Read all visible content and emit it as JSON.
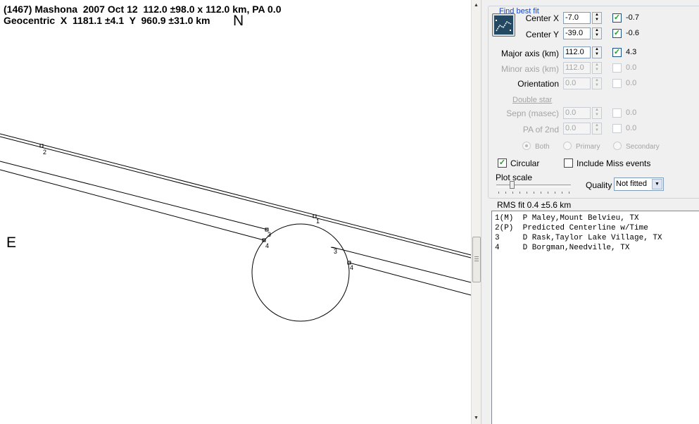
{
  "plot": {
    "header_line1": "(1467) Mashona  2007 Oct 12  112.0 ±98.0 x 112.0 km, PA 0.0",
    "header_line2": "Geocentric  X  1181.1 ±4.1  Y  960.9 ±31.0 km",
    "north_label": "N",
    "east_label": "E",
    "chord_markers": [
      {
        "label": "2"
      },
      {
        "label": "1"
      },
      {
        "label": "3"
      },
      {
        "label": "4"
      },
      {
        "label": "3"
      },
      {
        "label": "4"
      }
    ]
  },
  "panel": {
    "group_title": "Find best fit",
    "fit_button_icon": "fit-chart-icon",
    "params": [
      {
        "label": "Center X",
        "value": "-7.0",
        "checked": true,
        "result": "-0.7",
        "enabled": true
      },
      {
        "label": "Center Y",
        "value": "-39.0",
        "checked": true,
        "result": "-0.6",
        "enabled": true
      },
      {
        "label": "Major axis (km)",
        "value": "112.0",
        "checked": true,
        "result": "4.3",
        "enabled": true
      },
      {
        "label": "Minor axis (km)",
        "value": "112.0",
        "checked": false,
        "result": "0.0",
        "enabled": false
      },
      {
        "label": "Orientation",
        "value": "0.0",
        "checked": false,
        "result": "0.0",
        "enabled": false
      }
    ],
    "double_star_label": "Double star",
    "double_star": [
      {
        "label": "Sepn (masec)",
        "value": "0.0",
        "checked": false,
        "result": "0.0"
      },
      {
        "label": "PA of 2nd",
        "value": "0.0",
        "checked": false,
        "result": "0.0"
      }
    ],
    "radios": [
      "Both",
      "Primary",
      "Secondary"
    ],
    "radio_selected": "Both",
    "circular_label": "Circular",
    "circular_checked": true,
    "miss_label": "Include Miss events",
    "miss_checked": false,
    "plot_scale_label": "Plot scale",
    "plot_scale_level": 0.22,
    "quality_label": "Quality",
    "quality_value": "Not fitted",
    "rms_text": "RMS fit 0.4 ±5.6 km",
    "observers": [
      "1(M)  P Maley,Mount Belvieu, TX",
      "2(P)  Predicted Centerline w/Time",
      "3     D Rask,Taylor Lake Village, TX",
      "4     D Borgman,Needville, TX"
    ]
  }
}
